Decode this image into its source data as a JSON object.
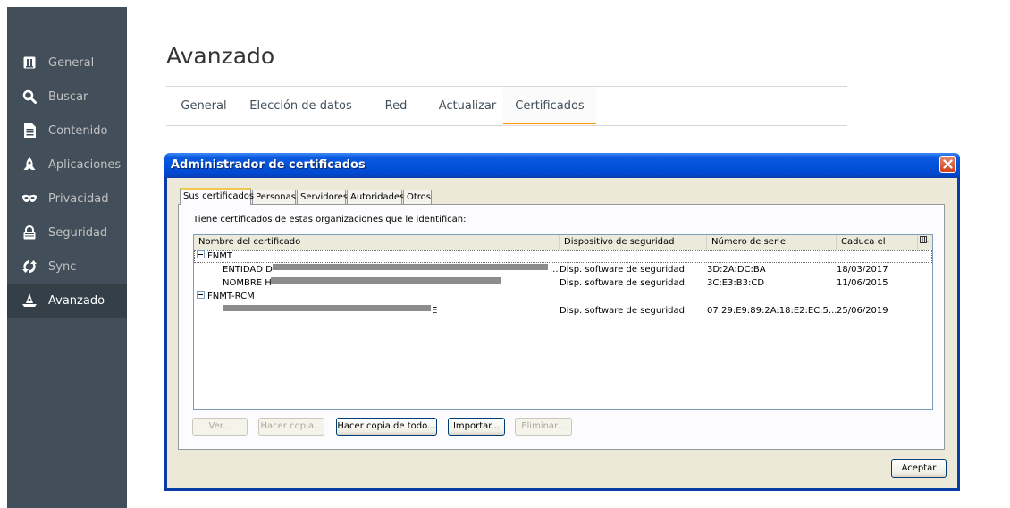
{
  "sidebar": {
    "items": [
      {
        "label": "General",
        "icon": "general-icon"
      },
      {
        "label": "Buscar",
        "icon": "search-icon"
      },
      {
        "label": "Contenido",
        "icon": "document-icon"
      },
      {
        "label": "Aplicaciones",
        "icon": "rocket-icon"
      },
      {
        "label": "Privacidad",
        "icon": "mask-icon"
      },
      {
        "label": "Seguridad",
        "icon": "lock-icon"
      },
      {
        "label": "Sync",
        "icon": "sync-icon"
      },
      {
        "label": "Avanzado",
        "icon": "wizard-hat-icon"
      }
    ],
    "active_index": 7
  },
  "page": {
    "title": "Avanzado",
    "tabs": [
      "General",
      "Elección de datos",
      "Red",
      "Actualizar",
      "Certificados"
    ],
    "active_tab_index": 4
  },
  "dialog": {
    "title": "Administrador de certificados",
    "tabs": [
      "Sus certificados",
      "Personas",
      "Servidores",
      "Autoridades",
      "Otros"
    ],
    "active_tab_index": 0,
    "intro_text": "Tiene certificados de estas organizaciones que le identifican:",
    "columns": [
      "Nombre del certificado",
      "Dispositivo de seguridad",
      "Número de serie",
      "Caduca el"
    ],
    "groups": [
      {
        "name": "FNMT",
        "rows": [
          {
            "name": "ENTIDAD D",
            "device": "Disp. software de seguridad",
            "serial": "3D:2A:DC:BA",
            "expires": "18/03/2017"
          },
          {
            "name": "NOMBRE H",
            "device": "Disp. software de seguridad",
            "serial": "3C:E3:B3:CD",
            "expires": "11/06/2015"
          }
        ]
      },
      {
        "name": "FNMT-RCM",
        "rows": [
          {
            "name": "E",
            "device": "Disp. software de seguridad",
            "serial": "07:29:E9:89:2A:18:E2:EC:5...",
            "expires": "25/06/2019"
          }
        ]
      }
    ],
    "buttons": {
      "view": "Ver...",
      "backup": "Hacer copia...",
      "backup_all": "Hacer copia de todo...",
      "import": "Importar...",
      "delete": "Eliminar..."
    },
    "ok": "Aceptar"
  },
  "colors": {
    "sidebar_bg": "#424f5a",
    "sidebar_active": "#343f48",
    "tab_accent": "#ff9500",
    "titlebar": "#0051d8"
  }
}
